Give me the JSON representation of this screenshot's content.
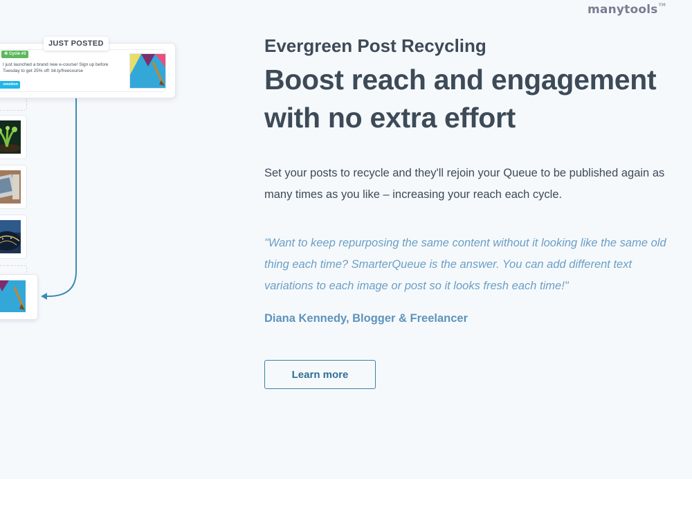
{
  "brand": {
    "logo_text": "manytools",
    "logo_mark": "TM"
  },
  "illustration": {
    "badge_label": "JUST POSTED",
    "cycle_label": "Cycle #3",
    "post_text": "I just launched a brand new e-course! Sign up before Tuesday to get 25% off: bit.ly/freecourse",
    "tag_label": "omotion",
    "icons": [
      "recycle-icon",
      "post-thumbnail",
      "queue-thumbnail-plant",
      "queue-thumbnail-laptop",
      "queue-thumbnail-city"
    ]
  },
  "content": {
    "kicker": "Evergreen Post Recycling",
    "headline": "Boost reach and engagement with no extra effort",
    "description": "Set your posts to recycle and they'll rejoin your Queue to be published again as many times as you like – increasing your reach each cycle.",
    "quote": "\"Want to keep repurposing the same content without it looking like the same old thing each time? SmarterQueue is the answer. You can add different text variations to each image or post so it looks fresh each time!\"",
    "author": "Diana Kennedy, Blogger & Freelancer",
    "cta_label": "Learn more"
  },
  "colors": {
    "heading": "#3d4a57",
    "quote": "#6a9fc4",
    "author": "#5d93bb",
    "button_border": "#3d7fa6",
    "section_bg": "#f6f9fc",
    "connector": "#3a8bb5"
  }
}
